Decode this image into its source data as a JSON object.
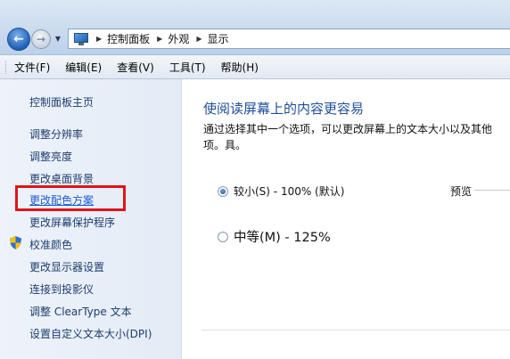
{
  "address": {
    "breadcrumbs": [
      "控制面板",
      "外观",
      "显示"
    ]
  },
  "menu": [
    "文件(F)",
    "编辑(E)",
    "查看(V)",
    "工具(T)",
    "帮助(H)"
  ],
  "sidebar": {
    "items": [
      {
        "label": "控制面板主页"
      },
      {
        "label": "调整分辨率"
      },
      {
        "label": "调整亮度"
      },
      {
        "label": "更改桌面背景"
      },
      {
        "label": "更改配色方案",
        "active": true
      },
      {
        "label": "更改屏幕保护程序"
      },
      {
        "label": "校准颜色",
        "icon": "shield-icon"
      },
      {
        "label": "更改显示器设置"
      },
      {
        "label": "连接到投影仪"
      },
      {
        "label": "调整 ClearType 文本"
      },
      {
        "label": "设置自定义文本大小(DPI)"
      }
    ]
  },
  "main": {
    "title": "使阅读屏幕上的内容更容易",
    "description": "通过选择其中一个选项，可以更改屏幕上的文本大小以及其他项。具。",
    "options": [
      {
        "label": "较小(S) - 100% (默认)",
        "checked": true
      },
      {
        "label": "中等(M) - 125%",
        "checked": false
      }
    ],
    "preview_label": "预览"
  },
  "colors": {
    "link": "#1e3c6e",
    "active_link": "#1a5bd6",
    "heading": "#1f4e99",
    "highlight": "#e0141a"
  }
}
